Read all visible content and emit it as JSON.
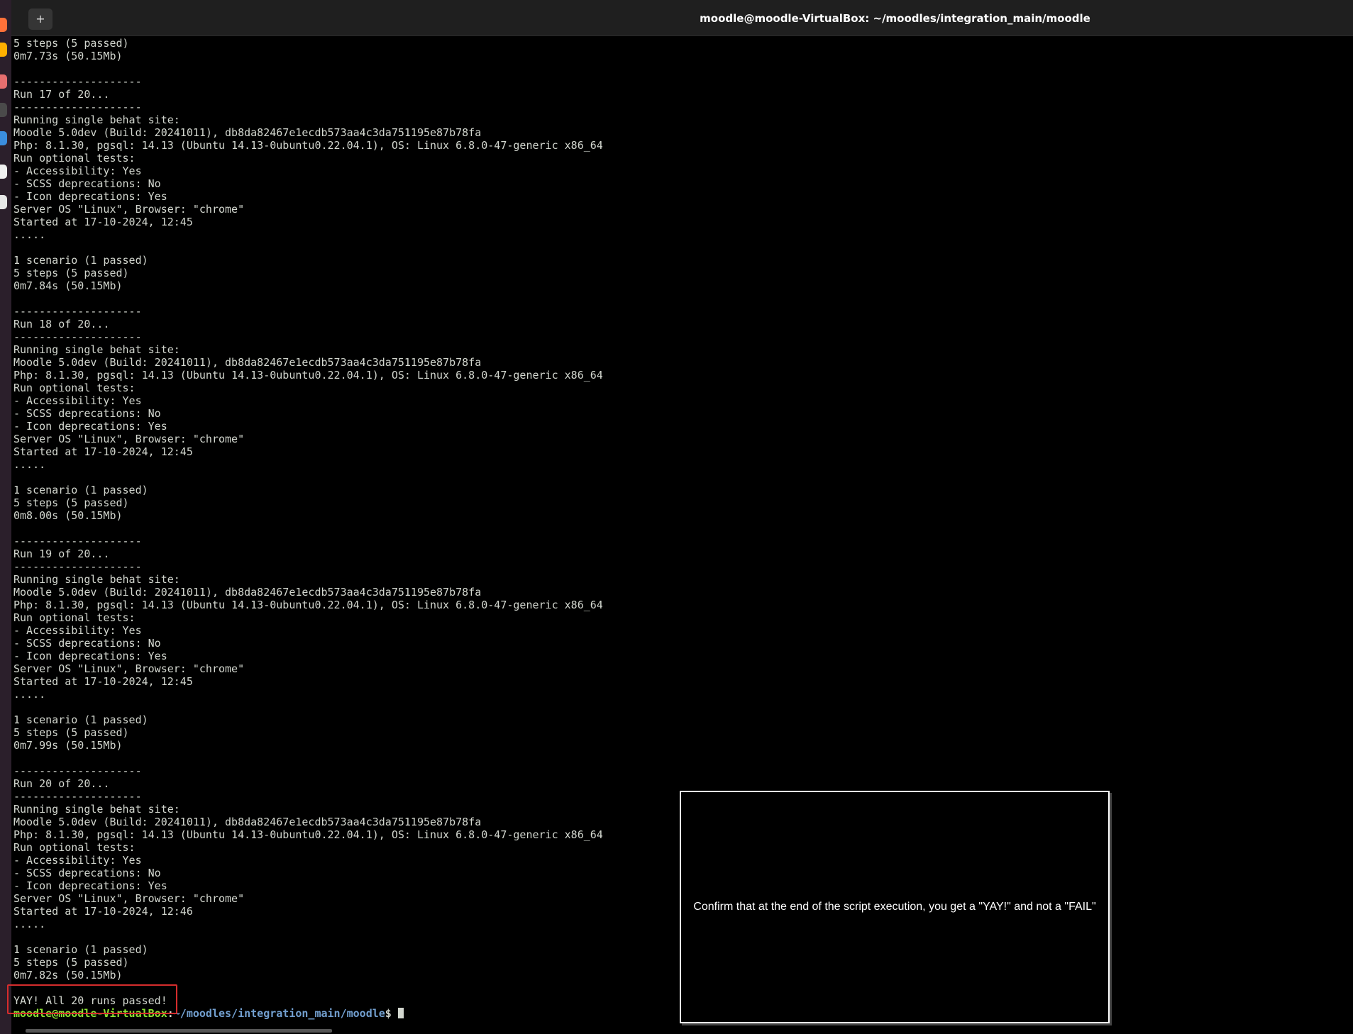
{
  "window": {
    "title": "moodle@moodle-VirtualBox: ~/moodles/integration_main/moodle",
    "new_tab_icon": "+"
  },
  "dock": {
    "icons": [
      {
        "name": "firefox-icon",
        "color": "#ff7139"
      },
      {
        "name": "thunderbird-icon",
        "color": "#ffb000"
      },
      {
        "name": "files-icon",
        "color": "#e66f6f"
      },
      {
        "name": "terminal-icon",
        "color": "#4a4a4a"
      },
      {
        "name": "help-icon",
        "color": "#3b8ede"
      },
      {
        "name": "text-editor-icon",
        "color": "#f0f0f0"
      },
      {
        "name": "software-icon",
        "color": "#e8e8e8"
      }
    ]
  },
  "terminal": {
    "lines": [
      "5 steps (5 passed)",
      "0m7.73s (50.15Mb)",
      "",
      "--------------------",
      "Run 17 of 20...",
      "--------------------",
      "Running single behat site:",
      "Moodle 5.0dev (Build: 20241011), db8da82467e1ecdb573aa4c3da751195e87b78fa",
      "Php: 8.1.30, pgsql: 14.13 (Ubuntu 14.13-0ubuntu0.22.04.1), OS: Linux 6.8.0-47-generic x86_64",
      "Run optional tests:",
      "- Accessibility: Yes",
      "- SCSS deprecations: No",
      "- Icon deprecations: Yes",
      "Server OS \"Linux\", Browser: \"chrome\"",
      "Started at 17-10-2024, 12:45",
      ".....",
      "",
      "1 scenario (1 passed)",
      "5 steps (5 passed)",
      "0m7.84s (50.15Mb)",
      "",
      "--------------------",
      "Run 18 of 20...",
      "--------------------",
      "Running single behat site:",
      "Moodle 5.0dev (Build: 20241011), db8da82467e1ecdb573aa4c3da751195e87b78fa",
      "Php: 8.1.30, pgsql: 14.13 (Ubuntu 14.13-0ubuntu0.22.04.1), OS: Linux 6.8.0-47-generic x86_64",
      "Run optional tests:",
      "- Accessibility: Yes",
      "- SCSS deprecations: No",
      "- Icon deprecations: Yes",
      "Server OS \"Linux\", Browser: \"chrome\"",
      "Started at 17-10-2024, 12:45",
      ".....",
      "",
      "1 scenario (1 passed)",
      "5 steps (5 passed)",
      "0m8.00s (50.15Mb)",
      "",
      "--------------------",
      "Run 19 of 20...",
      "--------------------",
      "Running single behat site:",
      "Moodle 5.0dev (Build: 20241011), db8da82467e1ecdb573aa4c3da751195e87b78fa",
      "Php: 8.1.30, pgsql: 14.13 (Ubuntu 14.13-0ubuntu0.22.04.1), OS: Linux 6.8.0-47-generic x86_64",
      "Run optional tests:",
      "- Accessibility: Yes",
      "- SCSS deprecations: No",
      "- Icon deprecations: Yes",
      "Server OS \"Linux\", Browser: \"chrome\"",
      "Started at 17-10-2024, 12:45",
      ".....",
      "",
      "1 scenario (1 passed)",
      "5 steps (5 passed)",
      "0m7.99s (50.15Mb)",
      "",
      "--------------------",
      "Run 20 of 20...",
      "--------------------",
      "Running single behat site:",
      "Moodle 5.0dev (Build: 20241011), db8da82467e1ecdb573aa4c3da751195e87b78fa",
      "Php: 8.1.30, pgsql: 14.13 (Ubuntu 14.13-0ubuntu0.22.04.1), OS: Linux 6.8.0-47-generic x86_64",
      "Run optional tests:",
      "- Accessibility: Yes",
      "- SCSS deprecations: No",
      "- Icon deprecations: Yes",
      "Server OS \"Linux\", Browser: \"chrome\"",
      "Started at 17-10-2024, 12:46",
      ".....",
      "",
      "1 scenario (1 passed)",
      "5 steps (5 passed)",
      "0m7.82s (50.15Mb)",
      "",
      "YAY! All 20 runs passed!"
    ],
    "prompt": {
      "user_host": "moodle@moodle-VirtualBox",
      "separator": ":",
      "path": "~/moodles/integration_main/moodle",
      "sign": "$ "
    }
  },
  "callout": {
    "text": "Confirm that at the end of the script execution, you get a \"YAY!\" and not a \"FAIL\""
  },
  "colors": {
    "terminal_fg": "#d3d7cf",
    "prompt_user": "#8ae234",
    "prompt_path": "#729fcf",
    "highlight": "#d62d2d"
  }
}
